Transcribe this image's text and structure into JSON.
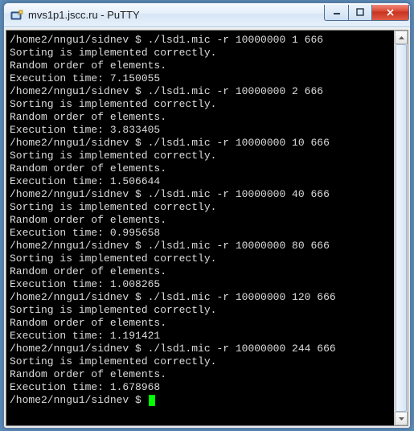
{
  "window": {
    "title": "mvs1p1.jscc.ru - PuTTY"
  },
  "terminal": {
    "prompt_path": "/home2/nngu1/sidnev $",
    "sorting_line": "Sorting is implemented correctly.",
    "random_line": "Random order of elements.",
    "runs": [
      {
        "cmd": "./lsd1.mic -r 10000000 1 666",
        "time_line": "Execution time: 7.150055"
      },
      {
        "cmd": "./lsd1.mic -r 10000000 2 666",
        "time_line": "Execution time: 3.833405"
      },
      {
        "cmd": "./lsd1.mic -r 10000000 10 666",
        "time_line": "Execution time: 1.506644"
      },
      {
        "cmd": "./lsd1.mic -r 10000000 40 666",
        "time_line": "Execution time: 0.995658"
      },
      {
        "cmd": "./lsd1.mic -r 10000000 80 666",
        "time_line": "Execution time: 1.008265"
      },
      {
        "cmd": "./lsd1.mic -r 10000000 120 666",
        "time_line": "Execution time: 1.191421"
      },
      {
        "cmd": "./lsd1.mic -r 10000000 244 666",
        "time_line": "Execution time: 1.678968"
      }
    ]
  }
}
